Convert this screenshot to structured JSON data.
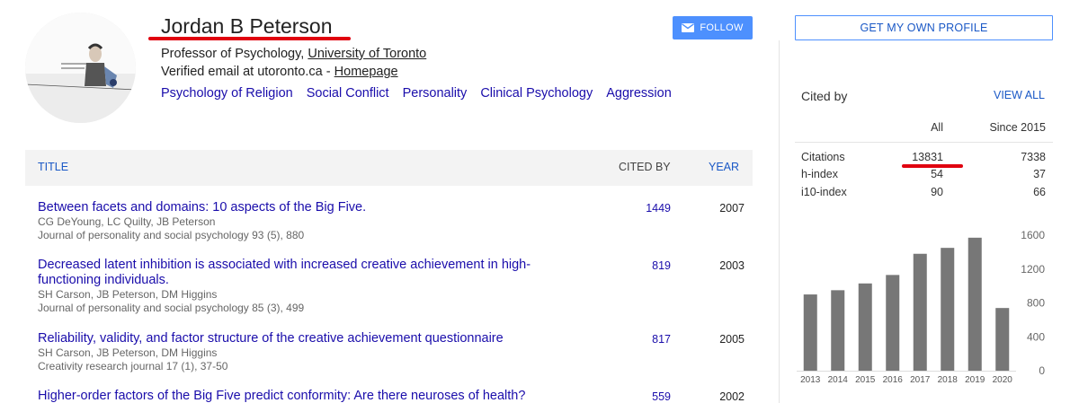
{
  "profile": {
    "name": "Jordan B Peterson",
    "position": "Professor of Psychology,",
    "institution": "University of Toronto",
    "email_text": "Verified email at utoronto.ca",
    "email_sep": "-",
    "homepage": "Homepage",
    "interests": [
      "Psychology of Religion",
      "Social Conflict",
      "Personality",
      "Clinical Psychology",
      "Aggression"
    ]
  },
  "buttons": {
    "follow": "FOLLOW",
    "get_profile": "GET MY OWN PROFILE"
  },
  "table": {
    "headers": {
      "title": "TITLE",
      "cited_by": "CITED BY",
      "year": "YEAR"
    },
    "rows": [
      {
        "title": "Between facets and domains: 10 aspects of the Big Five.",
        "authors": "CG DeYoung, LC Quilty, JB Peterson",
        "journal": "Journal of personality and social psychology 93 (5), 880",
        "cited": "1449",
        "year": "2007"
      },
      {
        "title": "Decreased latent inhibition is associated with increased creative achievement in high-functioning individuals.",
        "authors": "SH Carson, JB Peterson, DM Higgins",
        "journal": "Journal of personality and social psychology 85 (3), 499",
        "cited": "819",
        "year": "2003"
      },
      {
        "title": "Reliability, validity, and factor structure of the creative achievement questionnaire",
        "authors": "SH Carson, JB Peterson, DM Higgins",
        "journal": "Creativity research journal 17 (1), 37-50",
        "cited": "817",
        "year": "2005"
      },
      {
        "title": "Higher-order factors of the Big Five predict conformity: Are there neuroses of health?",
        "authors": "",
        "journal": "",
        "cited": "559",
        "year": "2002"
      }
    ]
  },
  "cited_by": {
    "heading": "Cited by",
    "view_all": "VIEW ALL",
    "col_all": "All",
    "col_since": "Since 2015",
    "stats": [
      {
        "label": "Citations",
        "all": "13831",
        "since": "7338"
      },
      {
        "label": "h-index",
        "all": "54",
        "since": "37"
      },
      {
        "label": "i10-index",
        "all": "90",
        "since": "66"
      }
    ]
  },
  "chart_data": {
    "type": "bar",
    "categories": [
      "2013",
      "2014",
      "2015",
      "2016",
      "2017",
      "2018",
      "2019",
      "2020"
    ],
    "values": [
      900,
      950,
      1030,
      1130,
      1380,
      1450,
      1570,
      740
    ],
    "ylim": [
      0,
      1600
    ],
    "yticks": [
      "1600",
      "1200",
      "800",
      "400",
      "0"
    ],
    "bar_color": "#777777"
  },
  "colors": {
    "link": "#1a0dab",
    "accent": "#4d90fe",
    "highlight": "#e0000f"
  }
}
